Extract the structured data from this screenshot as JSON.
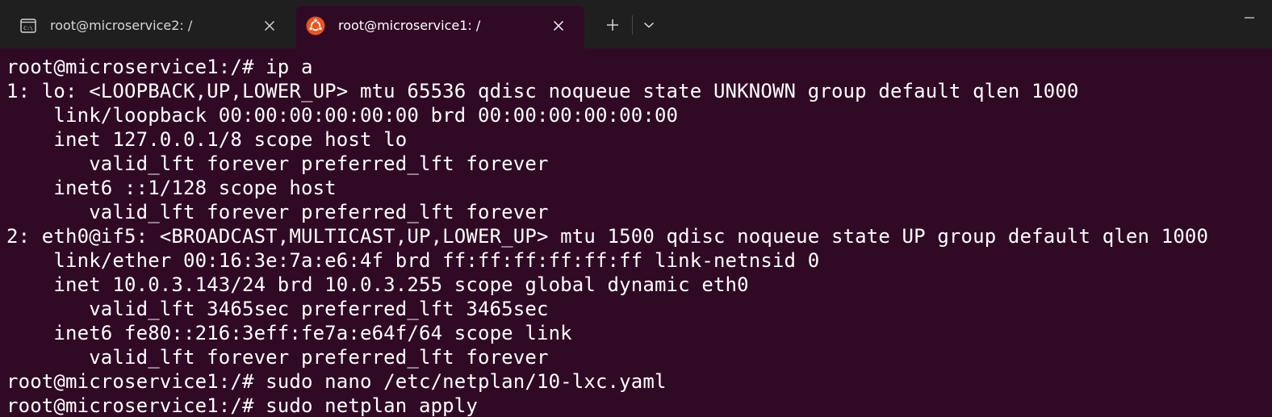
{
  "tabs": [
    {
      "title": "root@microservice2: /",
      "icon": "cmd-icon",
      "active": false
    },
    {
      "title": "root@microservice1: /",
      "icon": "ubuntu-icon",
      "active": true
    }
  ],
  "colors": {
    "terminal_bg": "#300a24",
    "tabbar_bg": "#1f1f1f",
    "ubuntu_orange": "#e95420",
    "text": "#ffffff"
  },
  "terminal": {
    "lines": [
      "root@microservice1:/# ip a",
      "1: lo: <LOOPBACK,UP,LOWER_UP> mtu 65536 qdisc noqueue state UNKNOWN group default qlen 1000",
      "    link/loopback 00:00:00:00:00:00 brd 00:00:00:00:00:00",
      "    inet 127.0.0.1/8 scope host lo",
      "       valid_lft forever preferred_lft forever",
      "    inet6 ::1/128 scope host",
      "       valid_lft forever preferred_lft forever",
      "2: eth0@if5: <BROADCAST,MULTICAST,UP,LOWER_UP> mtu 1500 qdisc noqueue state UP group default qlen 1000",
      "    link/ether 00:16:3e:7a:e6:4f brd ff:ff:ff:ff:ff:ff link-netnsid 0",
      "    inet 10.0.3.143/24 brd 10.0.3.255 scope global dynamic eth0",
      "       valid_lft 3465sec preferred_lft 3465sec",
      "    inet6 fe80::216:3eff:fe7a:e64f/64 scope link",
      "       valid_lft forever preferred_lft forever",
      "root@microservice1:/# sudo nano /etc/netplan/10-lxc.yaml",
      "root@microservice1:/# sudo netplan apply"
    ]
  }
}
